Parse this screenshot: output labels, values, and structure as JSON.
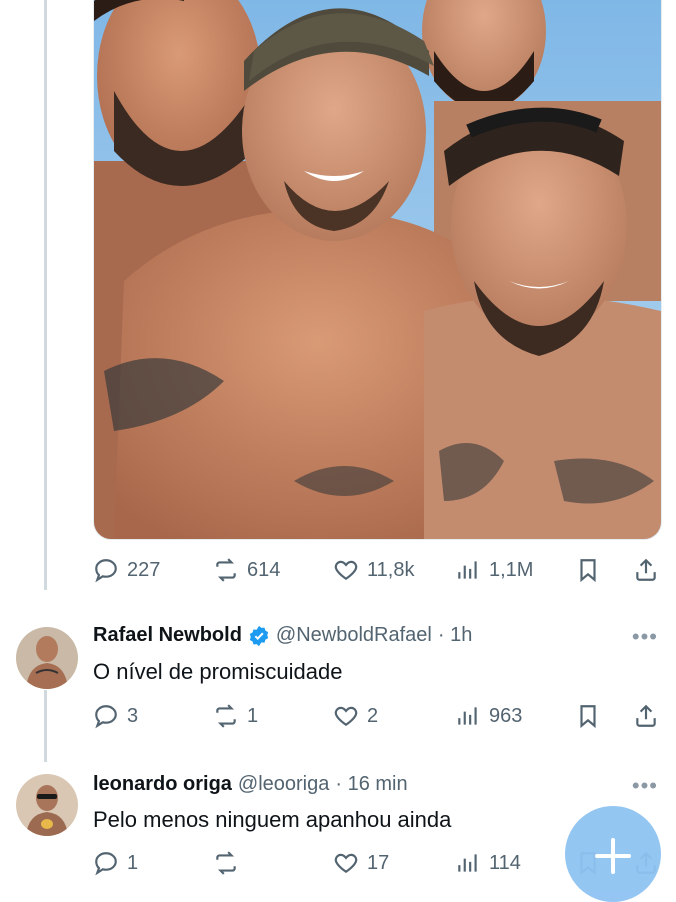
{
  "post": {
    "stats": {
      "replies": "227",
      "reposts": "614",
      "likes": "11,8k",
      "views": "1,1M"
    }
  },
  "replies": [
    {
      "name": "Rafael Newbold",
      "verified": true,
      "handle": "@NewboldRafael",
      "time": "· 1h",
      "text": "O nível de promiscuidade",
      "stats": {
        "replies": "3",
        "reposts": "1",
        "likes": "2",
        "views": "963"
      }
    },
    {
      "name": "leonardo origa",
      "verified": false,
      "handle": "@leooriga",
      "time": "· 16 min",
      "text": "Pelo menos ninguem apanhou ainda",
      "stats": {
        "replies": "1",
        "reposts": "",
        "likes": "17",
        "views": "114"
      }
    }
  ],
  "more_icon": "•••",
  "colors": {
    "verified": "#1d9bf0",
    "icon": "#536471",
    "fab": "#1d9bf0"
  },
  "icons": [
    "reply-icon",
    "repost-icon",
    "like-icon",
    "views-icon",
    "bookmark-icon",
    "share-icon",
    "compose-icon",
    "verified-badge-icon"
  ]
}
